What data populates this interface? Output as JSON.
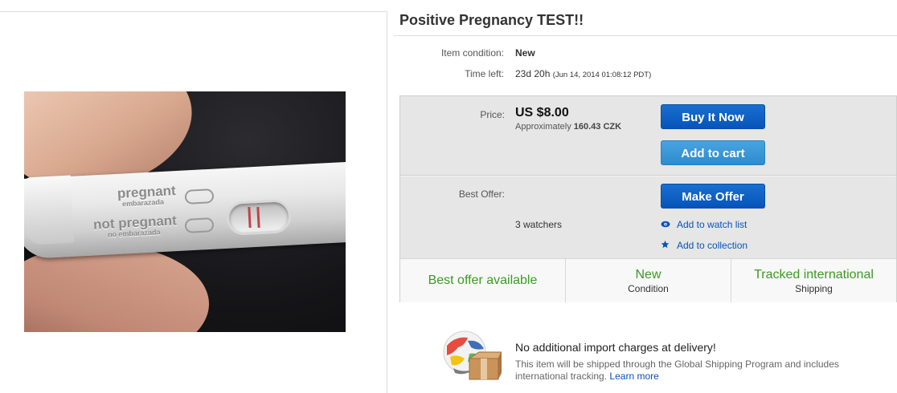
{
  "listing": {
    "title": "Positive Pregnancy TEST!!",
    "image_alt": "photo of pregnancy test",
    "image_text": {
      "line1": "pregnant",
      "line2": "embarazada",
      "line3": "not pregnant",
      "line4": "no embarazada"
    }
  },
  "details": {
    "condition_label": "Item condition:",
    "condition_value": "New",
    "time_left_label": "Time left:",
    "time_left_value": "23d 20h",
    "time_left_detail": "(Jun 14, 2014  01:08:12 PDT)"
  },
  "buy_box": {
    "price_label": "Price:",
    "price_value": "US $8.00",
    "approx_prefix": "Approximately",
    "approx_value": "160.43 CZK",
    "buy_now_label": "Buy It Now",
    "add_to_cart_label": "Add to cart",
    "best_offer_label": "Best Offer:",
    "make_offer_label": "Make Offer",
    "watchers_text": "3 watchers",
    "watch_link_label": "Add to watch list",
    "collection_link_label": "Add to collection"
  },
  "badges": [
    {
      "title": "Best offer available",
      "subtitle": ""
    },
    {
      "title": "New",
      "subtitle": "Condition"
    },
    {
      "title": "Tracked international",
      "subtitle": "Shipping"
    }
  ],
  "shipping": {
    "title": "No additional import charges at delivery!",
    "text": "This item will be shipped through the Global Shipping Program and includes international tracking.",
    "learn_more": "Learn more"
  },
  "colors": {
    "primary_button": "#0654ba",
    "secondary_button": "#2d8ccf",
    "badge_green": "#3c9a26",
    "link_blue": "#0654ba"
  },
  "icons": {
    "watch": "eye-icon",
    "collection": "star-icon",
    "shipping": "globe-box-icon"
  }
}
